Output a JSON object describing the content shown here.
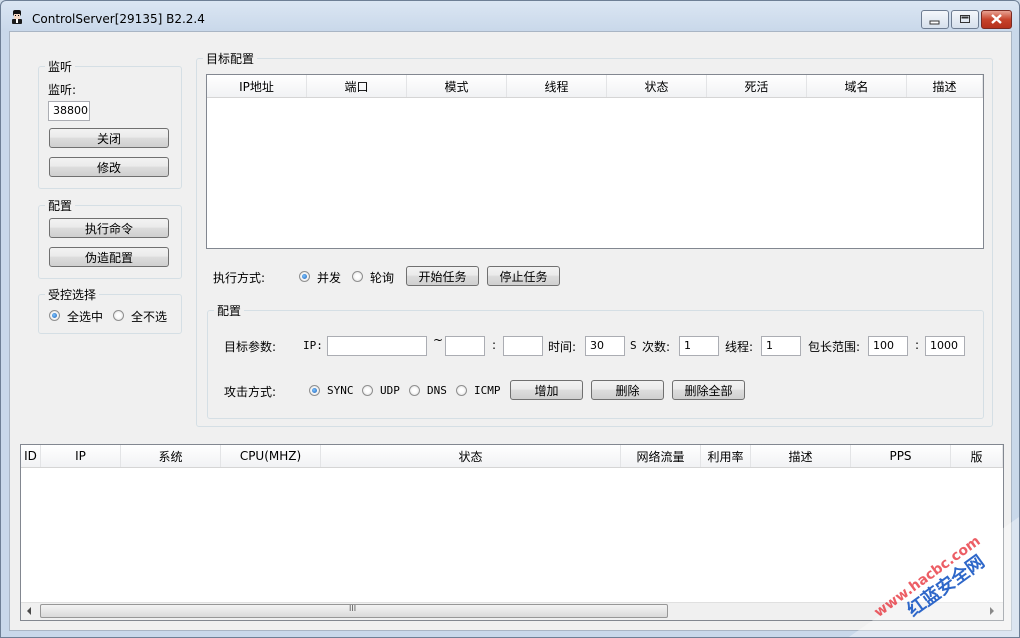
{
  "window": {
    "title": "ControlServer[29135] B2.2.4"
  },
  "listen": {
    "group_title": "监听",
    "label": "监听:",
    "port_value": "38800",
    "close_label": "关闭",
    "modify_label": "修改"
  },
  "config": {
    "group_title": "配置",
    "exec_cmd_label": "执行命令",
    "fake_config_label": "伪造配置"
  },
  "selection": {
    "group_title": "受控选择",
    "select_all_label": "全选中",
    "select_none_label": "全不选"
  },
  "target_config": {
    "group_title": "目标配置",
    "columns": [
      "IP地址",
      "端口",
      "模式",
      "线程",
      "状态",
      "死活",
      "域名",
      "描述"
    ]
  },
  "execution": {
    "label": "执行方式:",
    "parallel_label": "并发",
    "poll_label": "轮询",
    "start_label": "开始任务",
    "stop_label": "停止任务"
  },
  "params": {
    "group_title": "配置",
    "target_label": "目标参数:",
    "ip_label": "IP:",
    "tilde": "~",
    "colon": ":",
    "time_label": "时间:",
    "time_value": "30",
    "time_unit": "S",
    "count_label": "次数:",
    "count_value": "1",
    "thread_label": "线程:",
    "thread_value": "1",
    "packet_label": "包长范围:",
    "packet_min": "100",
    "packet_max": "1000",
    "attack_label": "攻击方式:",
    "methods": [
      "SYNC",
      "UDP",
      "DNS",
      "ICMP"
    ],
    "add_label": "增加",
    "delete_label": "删除",
    "delete_all_label": "删除全部"
  },
  "clients": {
    "columns": [
      "ID",
      "IP",
      "系统",
      "CPU(MHZ)",
      "状态",
      "网络流量",
      "利用率",
      "描述",
      "PPS",
      "版"
    ],
    "scroll_grip": "III"
  },
  "watermark": {
    "text": "红蓝安全网",
    "url": "www.hacbc.com"
  },
  "colors": {
    "title_bg": "#c9d8ea",
    "client_bg": "#f0f0f0",
    "close_button": "#c7432c",
    "watermark": "#e8363f"
  }
}
